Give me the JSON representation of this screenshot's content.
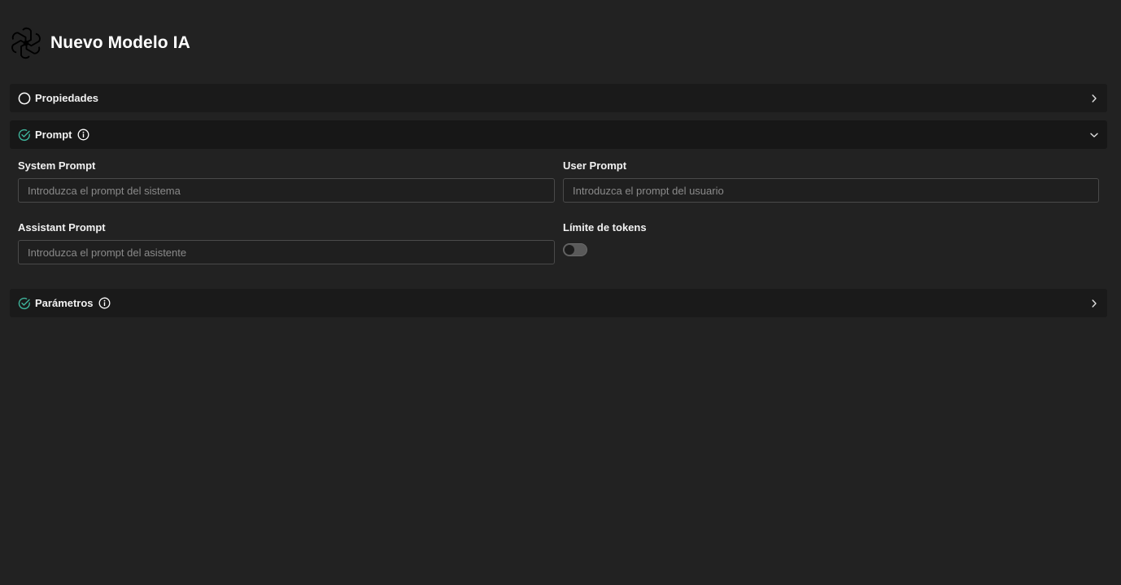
{
  "header": {
    "title": "Nuevo Modelo IA",
    "logo_icon": "openai-logo-icon"
  },
  "sections": {
    "properties": {
      "title": "Propiedades",
      "status": "incomplete",
      "expanded": false
    },
    "prompt": {
      "title": "Prompt",
      "status": "complete",
      "expanded": true,
      "has_info": true
    },
    "parameters": {
      "title": "Parámetros",
      "status": "complete",
      "expanded": false,
      "has_info": true
    }
  },
  "form": {
    "system_prompt": {
      "label": "System Prompt",
      "placeholder": "Introduzca el prompt del sistema",
      "value": ""
    },
    "user_prompt": {
      "label": "User Prompt",
      "placeholder": "Introduzca el prompt del usuario",
      "value": ""
    },
    "assistant_prompt": {
      "label": "Assistant Prompt",
      "placeholder": "Introduzca el prompt del asistente",
      "value": ""
    },
    "token_limit": {
      "label": "Límite de tokens",
      "enabled": false
    }
  },
  "colors": {
    "background": "#222222",
    "section_bg": "#1a1a1a",
    "accent_check": "#3fb59c",
    "text": "#f2f2f2",
    "placeholder": "#8a8a8a"
  }
}
